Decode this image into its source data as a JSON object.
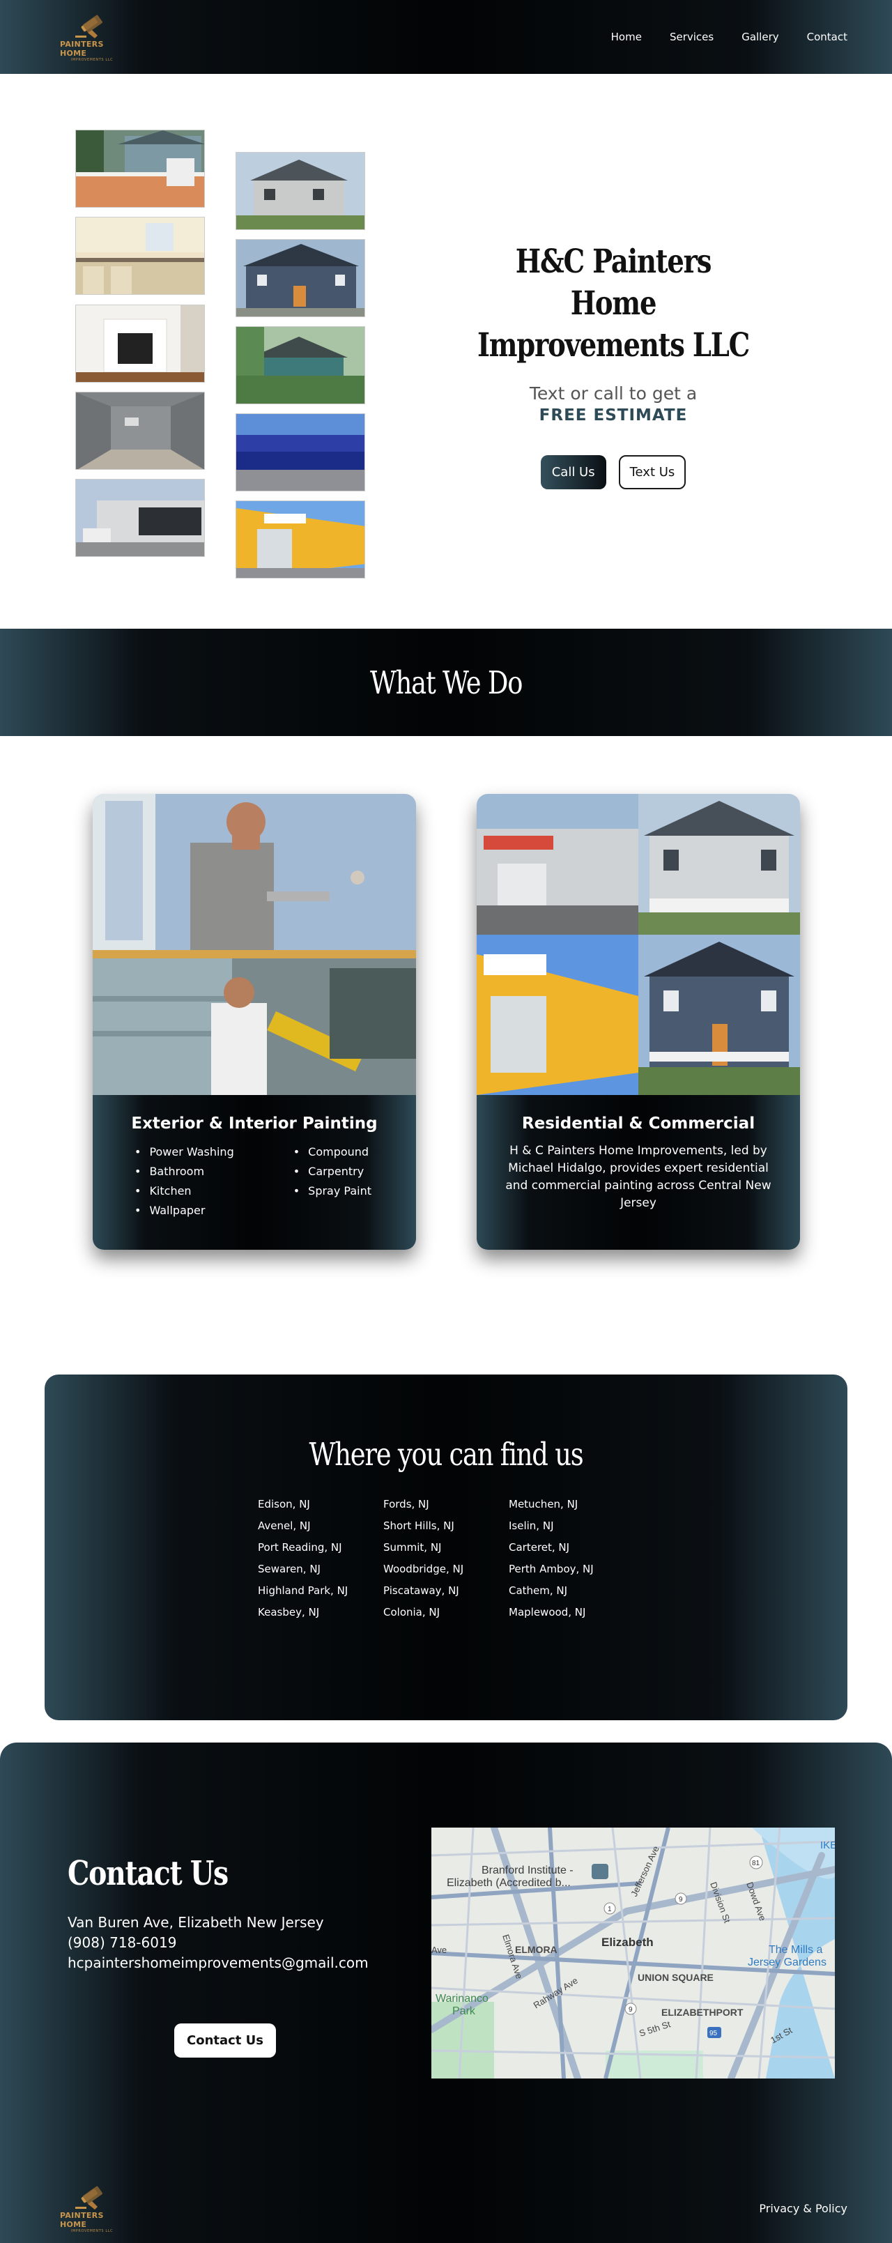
{
  "header": {
    "logo_text": "PAINTERS HOME",
    "logo_sub": "IMPROVEMENTS LLC",
    "nav": [
      "Home",
      "Services",
      "Gallery",
      "Contact"
    ]
  },
  "hero": {
    "title_line1": "H&C Painters",
    "title_line2": "Home Improvements LLC",
    "subtitle": "Text or call to get a",
    "cta": "FREE ESTIMATE",
    "call_button": "Call Us",
    "text_button": "Text Us"
  },
  "services": {
    "heading": "What We Do",
    "cards": [
      {
        "title": "Exterior & Interior Painting",
        "list_left": [
          "Power Washing",
          "Bathroom",
          "Kitchen",
          "Wallpaper"
        ],
        "list_right": [
          "Compound",
          "Carpentry",
          "Spray Paint"
        ]
      },
      {
        "title": "Residential & Commercial",
        "description": "H & C Painters Home Improvements, led by Michael Hidalgo, provides expert residential and commercial painting across Central New Jersey"
      }
    ]
  },
  "locations": {
    "heading": "Where you can find us",
    "columns": [
      [
        "Edison, NJ",
        "Avenel, NJ",
        "Port Reading, NJ",
        "Sewaren, NJ",
        "Highland Park, NJ",
        "Keasbey, NJ"
      ],
      [
        "Fords, NJ",
        "Short Hills, NJ",
        "Summit, NJ",
        "Woodbridge, NJ",
        "Piscataway, NJ",
        "Colonia, NJ"
      ],
      [
        "Metuchen, NJ",
        "Iselin, NJ",
        "Carteret, NJ",
        "Perth Amboy, NJ",
        "Cathem, NJ",
        "Maplewood, NJ"
      ]
    ]
  },
  "contact": {
    "heading": "Contact Us",
    "address": "Van Buren Ave, Elizabeth New Jersey",
    "phone": "(908) 718-6019",
    "email": "hcpaintershomeimprovements@gmail.com",
    "button": "Contact Us",
    "map_labels": {
      "branford": "Branford Institute -",
      "branford2": "Elizabeth (Accredited b...",
      "elmora": "ELMORA",
      "elizabeth": "Elizabeth",
      "union_square": "UNION SQUARE",
      "elizabethport": "ELIZABETHPORT",
      "warinanco": "Warinanco",
      "park": "Park",
      "mills": "The Mills a",
      "jersey_gardens": "Jersey Gardens",
      "jefferson": "Jefferson Ave",
      "division": "Division St",
      "elmora_ave": "Elmora Ave",
      "rahway": "Rahway Ave",
      "s5th": "S 5th St",
      "first": "1st St",
      "dowd": "Dowd Ave",
      "ave": "Ave",
      "ike": "IKE",
      "r81": "81",
      "r1": "1",
      "r9": "9",
      "r95": "95",
      "r9b": "9"
    }
  },
  "footer": {
    "policy_link": "Privacy & Policy"
  },
  "colors": {
    "accent_teal": "#2e4a56",
    "dark": "#020405",
    "logo_gold": "#c8954a"
  }
}
